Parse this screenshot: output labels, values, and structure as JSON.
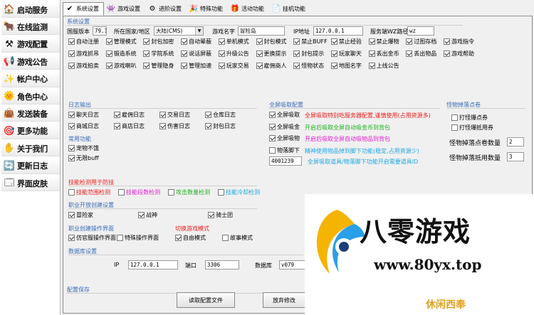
{
  "sidebar": [
    {
      "label": "启动服务",
      "icon": "🏠"
    },
    {
      "label": "在线监测",
      "icon": "🐂"
    },
    {
      "label": "游戏配置",
      "icon": "⚒"
    },
    {
      "label": "游戏公告",
      "icon": "📢"
    },
    {
      "label": "帐户中心",
      "icon": "✨"
    },
    {
      "label": "角色中心",
      "icon": "🌞"
    },
    {
      "label": "发送装备",
      "icon": "👜"
    },
    {
      "label": "更多功能",
      "icon": "🎯"
    },
    {
      "label": "关于我们",
      "icon": "✋"
    },
    {
      "label": "更新日志",
      "icon": "🔄"
    },
    {
      "label": "界面皮肤",
      "icon": "🗔"
    }
  ],
  "tabs": [
    {
      "label": "系统设置",
      "icon": "✔",
      "active": true
    },
    {
      "label": "游戏设置",
      "icon": "👾"
    },
    {
      "label": "进阶设置",
      "icon": "⚙"
    },
    {
      "label": "特殊功能",
      "icon": "🎉"
    },
    {
      "label": "活动功能",
      "icon": "🎁"
    },
    {
      "label": "挂机功能",
      "icon": "📄"
    }
  ],
  "system": {
    "section": "系统设置",
    "version_label": "国服版本",
    "version_value": "79.1",
    "region_label": "所在国家/地区",
    "region_value": "大陆(CMS)",
    "game_name_label": "游戏名字",
    "game_name_value": "冒险岛",
    "ip_label": "IP地址",
    "ip_value": "127.0.0.1",
    "wz_label": "服务端WZ路径",
    "wz_value": "wz"
  },
  "options_rows": [
    [
      "自动注册",
      "管理模式",
      "封包加密",
      "自动晕蔽",
      "单机模式",
      "封包模式",
      "禁止BUFF",
      "禁止经验",
      "禁止爆物",
      "过图存档",
      "游戏指令"
    ],
    [
      "游戏抓吊",
      "锻造系统",
      "学院系统",
      "说话屏蔽",
      "升级公告",
      "更换提示",
      "封包提示",
      "玩家聊天",
      "丢出金币",
      "丢出物品",
      "游戏帮助"
    ],
    [
      "游戏拍卖",
      "游戏喇叭",
      "管理隐身",
      "管理加速",
      "玩家交易",
      "雇佣商人",
      "怪物状态",
      "地图名字",
      "上线公告"
    ]
  ],
  "log": {
    "section": "日志输出",
    "items": [
      [
        "聊天日志",
        "雇佣日志",
        "交易日志",
        "仓库日志"
      ],
      [
        "商城日志",
        "商店日志",
        "伤害日志",
        "封包日志"
      ]
    ],
    "common_section": "常用功能",
    "common_items": [
      "宠物不饿",
      "无限buff"
    ]
  },
  "global_drop": {
    "section": "全屏吸取配置",
    "items": [
      {
        "label": "全屏吸取",
        "desc": "全屏吸取特别吃服务器配置,谨慎使用(占用资源多)",
        "color": "#e8201c"
      },
      {
        "label": "全屏吸金",
        "desc": "开启后吸取全屏自动吸金币到背包",
        "color": "#20b020"
      },
      {
        "label": "全屏吸物",
        "desc": "开启后吸取全屏自动吸物品到背包",
        "color": "#e020d0"
      },
      {
        "label": "物落脚下",
        "desc": "精神使用物品掉到脚下功能(稳定,占用资源少)",
        "color": "#20a8e0"
      }
    ],
    "item_id_value": "4001239",
    "item_id_desc": "全屏吸取道具/物落脚下功能开启需要道具ID"
  },
  "monster_drop": {
    "section": "怪物掉落点卷",
    "items": [
      "打怪爆点券",
      "打怪爆抵用券"
    ],
    "point_label": "怪物掉落点卷数量",
    "point_value": "2",
    "coupon_label": "怪物掉落抵用数量",
    "coupon_value": "3"
  },
  "anticheat": {
    "section": "技能检测用于防挂",
    "items": [
      {
        "label": "技能范围检测",
        "color": "#e8201c"
      },
      {
        "label": "技能段数检测",
        "color": "#e020d0"
      },
      {
        "label": "攻击数量检测",
        "color": "#20b020"
      },
      {
        "label": "技能冷却检测",
        "color": "#20a8e0"
      }
    ]
  },
  "job_open": {
    "section": "职业开放创建设置",
    "items": [
      "冒险家",
      "战神",
      "骑士团"
    ]
  },
  "job_ui": {
    "section": "职业创建操作界面",
    "items": [
      "仿官服操作界面",
      "特殊操作界面"
    ]
  },
  "mode": {
    "section": "切换游戏模式",
    "items": [
      "自由模式",
      "故事模式"
    ]
  },
  "db": {
    "section": "数据库设置",
    "ip_label": "IP",
    "ip_value": "127.0.0.1",
    "port_label": "端口",
    "port_value": "3306",
    "db_label": "数据库",
    "db_value": "v079"
  },
  "save": {
    "section": "配置保存",
    "read_label": "读取配置文件",
    "discard_label": "放弃修改",
    "save_label": "保存并马上生效"
  },
  "watermark": {
    "brand": "八零游戏",
    "url": "www.80yx.top",
    "stamp": "休闲西奉"
  }
}
